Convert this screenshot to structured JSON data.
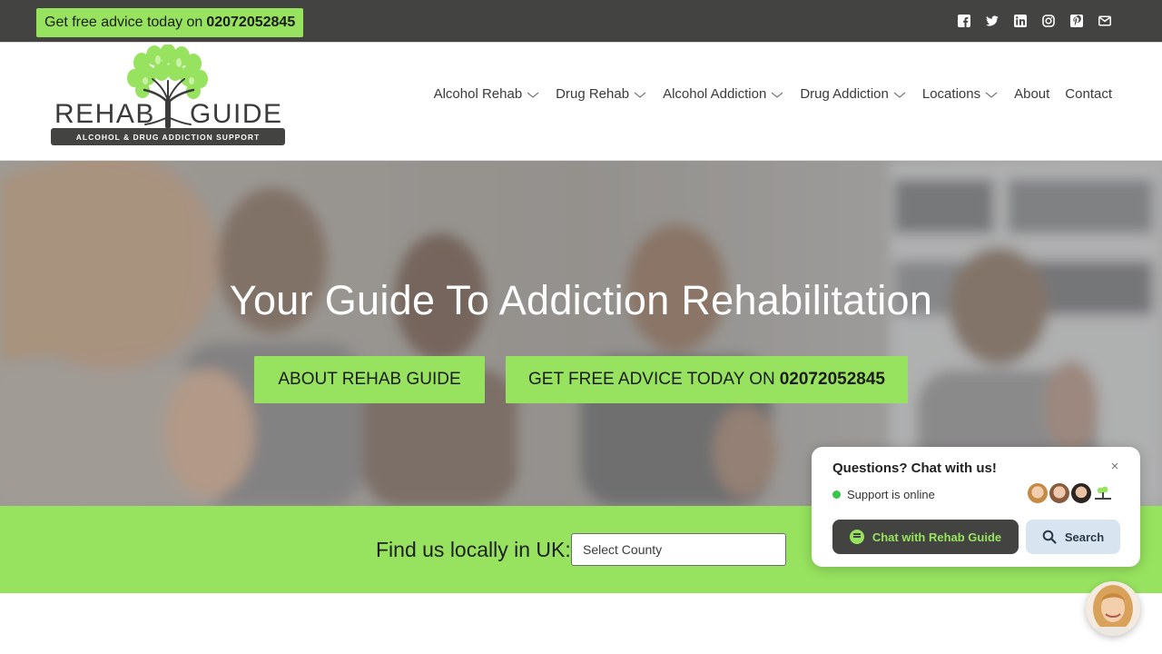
{
  "topbar": {
    "advice_text": "Get free advice today on",
    "advice_phone": "02072052845",
    "social_icons": [
      "facebook-icon",
      "twitter-icon",
      "linkedin-icon",
      "instagram-icon",
      "pinterest-icon",
      "email-icon"
    ]
  },
  "brand": {
    "word_left": "REHAB",
    "word_right": "GUIDE",
    "strapline": "ALCOHOL & DRUG ADDICTION SUPPORT",
    "colors": {
      "accent_green": "#97e35f",
      "dark": "#434441"
    }
  },
  "nav": {
    "items": [
      {
        "label": "Alcohol Rehab",
        "dropdown": true
      },
      {
        "label": "Drug Rehab",
        "dropdown": true
      },
      {
        "label": "Alcohol Addiction",
        "dropdown": true
      },
      {
        "label": "Drug Addiction",
        "dropdown": true
      },
      {
        "label": "Locations",
        "dropdown": true
      },
      {
        "label": "About",
        "dropdown": false
      },
      {
        "label": "Contact",
        "dropdown": false
      }
    ]
  },
  "hero": {
    "title": "Your Guide To Addiction Rehabilitation",
    "about_button": "ABOUT REHAB GUIDE",
    "advice_button_text": "GET FREE ADVICE TODAY ON",
    "advice_button_phone": "02072052845"
  },
  "find": {
    "label": "Find us locally in UK:",
    "select_value": "Select County"
  },
  "chat": {
    "title": "Questions? Chat with us!",
    "close": "×",
    "status": "Support is online",
    "chat_button": "Chat with Rehab Guide",
    "search_button": "Search"
  }
}
